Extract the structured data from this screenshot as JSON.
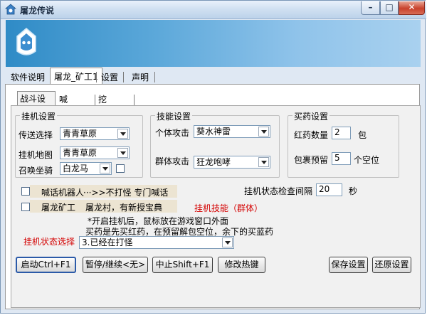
{
  "window": {
    "title": "屠龙传说",
    "minimize": "–",
    "maximize": "□",
    "close": "✕"
  },
  "main_tabs": [
    {
      "label": "软件说明"
    },
    {
      "label": "屠龙_矿工1"
    },
    {
      "label": "设置"
    },
    {
      "label": "声明"
    }
  ],
  "sub_tabs": [
    {
      "label": "战斗设置"
    },
    {
      "label": "喊话设置"
    },
    {
      "label": "挖矿设置"
    }
  ],
  "hook": {
    "title": "挂机设置",
    "teleport_label": "传送选择",
    "teleport_value": "青青草原",
    "map_label": "挂机地图",
    "map_value": "青青草原",
    "mount_label": "召唤坐骑",
    "mount_value": "白龙马"
  },
  "skills": {
    "title": "技能设置",
    "single_label": "个体攻击",
    "single_value": "葵水神雷",
    "group_label": "群体攻击",
    "group_value": "狂龙咆哮"
  },
  "potions": {
    "title": "买药设置",
    "red_label": "红药数量",
    "red_value": "2",
    "red_unit": "包",
    "bag_label": "包裹预留",
    "bag_value": "5",
    "bag_unit": "个空位"
  },
  "misc": {
    "shout_robot": "喊话机器人",
    "shout_note": "···>>不打怪 专门喊话",
    "miner": "屠龙矿工",
    "miner_note": "屠龙村，有新授宝典",
    "status_interval_label": "挂机状态检查间隔",
    "status_interval_value": "20",
    "status_interval_unit": "秒",
    "hook_skill_label": "挂机技能（群体）",
    "note1": "*开启挂机后，鼠标放在游戏窗口外面",
    "note2": "买药是先买红药，在预留解包空位，余下的买蓝药",
    "hook_state_label": "挂机状态选择",
    "hook_state_value": "3.已经在打怪"
  },
  "buttons": {
    "start": "启动Ctrl+F1",
    "pause": "暂停/继续<无>",
    "stop": "中止Shift+F1",
    "hotkeys": "修改热键",
    "save": "保存设置",
    "restore": "还原设置"
  },
  "colors": {
    "banner_start": "#2f8bc6",
    "banner_end": "#a9d1ef",
    "warning_red": "#d40000"
  }
}
